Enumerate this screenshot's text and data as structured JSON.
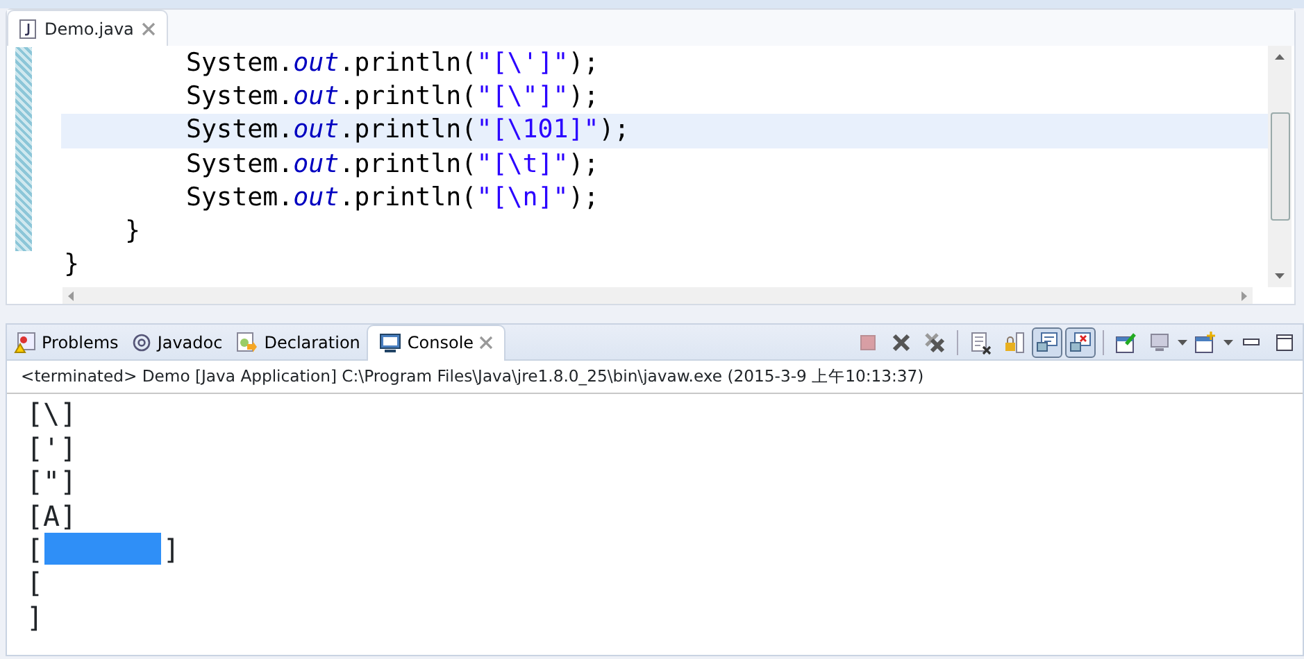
{
  "editor": {
    "tab": {
      "label": "Demo.java",
      "selected": true
    },
    "lines": [
      {
        "current": false,
        "tokens": [
          {
            "kind": "plain",
            "text": "        System."
          },
          {
            "kind": "field",
            "text": "out"
          },
          {
            "kind": "plain",
            "text": ".println("
          },
          {
            "kind": "string",
            "text": "\"[\\']\""
          },
          {
            "kind": "plain",
            "text": ");"
          }
        ]
      },
      {
        "current": false,
        "tokens": [
          {
            "kind": "plain",
            "text": "        System."
          },
          {
            "kind": "field",
            "text": "out"
          },
          {
            "kind": "plain",
            "text": ".println("
          },
          {
            "kind": "string",
            "text": "\"[\\\"]\""
          },
          {
            "kind": "plain",
            "text": ");"
          }
        ]
      },
      {
        "current": true,
        "tokens": [
          {
            "kind": "plain",
            "text": "        System."
          },
          {
            "kind": "field",
            "text": "out"
          },
          {
            "kind": "plain",
            "text": ".println("
          },
          {
            "kind": "string",
            "text": "\"[\\101]\""
          },
          {
            "kind": "plain",
            "text": ");"
          }
        ]
      },
      {
        "current": false,
        "tokens": [
          {
            "kind": "plain",
            "text": "        System."
          },
          {
            "kind": "field",
            "text": "out"
          },
          {
            "kind": "plain",
            "text": ".println("
          },
          {
            "kind": "string",
            "text": "\"[\\t]\""
          },
          {
            "kind": "plain",
            "text": ");"
          }
        ]
      },
      {
        "current": false,
        "tokens": [
          {
            "kind": "plain",
            "text": "        System."
          },
          {
            "kind": "field",
            "text": "out"
          },
          {
            "kind": "plain",
            "text": ".println("
          },
          {
            "kind": "string",
            "text": "\"[\\n]\""
          },
          {
            "kind": "plain",
            "text": ");"
          }
        ]
      },
      {
        "current": false,
        "tokens": [
          {
            "kind": "plain",
            "text": "    }"
          }
        ]
      },
      {
        "current": false,
        "tokens": [
          {
            "kind": "plain",
            "text": "}"
          }
        ]
      }
    ]
  },
  "views": {
    "tabs": [
      {
        "label": "Problems",
        "kind": "problems",
        "selected": false
      },
      {
        "label": "Javadoc",
        "kind": "javadoc",
        "selected": false
      },
      {
        "label": "Declaration",
        "kind": "declaration",
        "selected": false
      },
      {
        "label": "Console",
        "kind": "console",
        "selected": true
      }
    ],
    "toolbar": [
      {
        "kind": "terminate",
        "disabled": true,
        "pressed": false
      },
      {
        "kind": "remove",
        "disabled": false,
        "pressed": false
      },
      {
        "kind": "remove-all",
        "disabled": false,
        "pressed": false
      },
      {
        "kind": "sep"
      },
      {
        "kind": "clear",
        "disabled": false,
        "pressed": false
      },
      {
        "kind": "scroll-lock",
        "disabled": false,
        "pressed": false
      },
      {
        "kind": "stdout",
        "disabled": false,
        "pressed": true
      },
      {
        "kind": "stderr",
        "disabled": false,
        "pressed": true
      },
      {
        "kind": "sep"
      },
      {
        "kind": "pin",
        "disabled": false,
        "pressed": false
      },
      {
        "kind": "display",
        "disabled": false,
        "pressed": false
      },
      {
        "kind": "dropdown"
      },
      {
        "kind": "open",
        "disabled": false,
        "pressed": false
      },
      {
        "kind": "dropdown"
      },
      {
        "kind": "minimize"
      },
      {
        "kind": "maximize"
      }
    ]
  },
  "console": {
    "header": "<terminated> Demo [Java Application] C:\\Program Files\\Java\\jre1.8.0_25\\bin\\javaw.exe (2015-3-9 上午10:13:37)",
    "lines": [
      {
        "segments": [
          {
            "text": "[\\]",
            "selected": false
          }
        ]
      },
      {
        "segments": [
          {
            "text": "[']",
            "selected": false
          }
        ]
      },
      {
        "segments": [
          {
            "text": "[\"]",
            "selected": false
          }
        ]
      },
      {
        "segments": [
          {
            "text": "[A]",
            "selected": false
          }
        ]
      },
      {
        "segments": [
          {
            "text": "[",
            "selected": false
          },
          {
            "kind": "selection",
            "selected": true
          },
          {
            "text": "]",
            "selected": false
          }
        ]
      },
      {
        "segments": [
          {
            "text": "[",
            "selected": false
          }
        ]
      },
      {
        "segments": [
          {
            "text": "]",
            "selected": false
          }
        ]
      }
    ]
  }
}
